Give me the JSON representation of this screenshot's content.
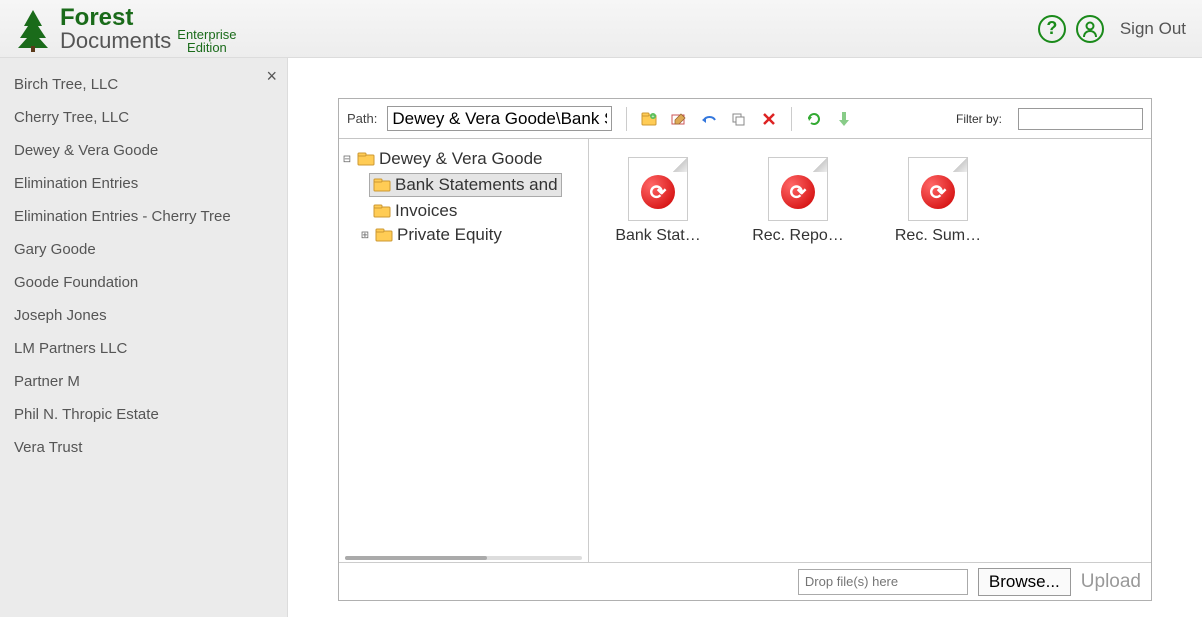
{
  "header": {
    "logo_top": "Forest",
    "logo_bottom": "Documents",
    "edition_top": "Enterprise",
    "edition_bottom": "Edition",
    "signout": "Sign Out"
  },
  "sidebar": {
    "items": [
      "Birch Tree, LLC",
      "Cherry Tree, LLC",
      "Dewey & Vera Goode",
      "Elimination Entries",
      "Elimination Entries - Cherry Tree",
      "Gary Goode",
      "Goode Foundation",
      "Joseph Jones",
      "LM Partners LLC",
      "Partner M",
      "Phil N. Thropic Estate",
      "Vera Trust"
    ]
  },
  "toolbar": {
    "path_label": "Path:",
    "path_value": "Dewey & Vera Goode\\Bank Statements and Reconciliations",
    "filter_label": "Filter by:",
    "filter_value": ""
  },
  "tree": {
    "root": "Dewey & Vera Goode",
    "children": [
      {
        "label": "Bank Statements and",
        "selected": true
      },
      {
        "label": "Invoices",
        "selected": false
      },
      {
        "label": "Private Equity",
        "selected": false,
        "expandable": true
      }
    ]
  },
  "files": [
    {
      "label": "Bank Stat…"
    },
    {
      "label": "Rec. Repo…"
    },
    {
      "label": "Rec. Sum…"
    }
  ],
  "footer": {
    "drop_placeholder": "Drop file(s) here",
    "browse": "Browse...",
    "upload": "Upload"
  }
}
